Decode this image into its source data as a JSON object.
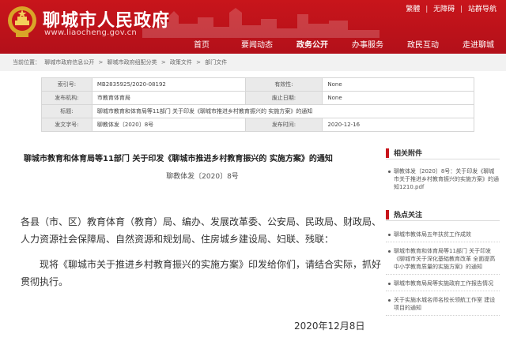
{
  "header": {
    "site_title": "聊城市人民政府",
    "site_url": "www.liaocheng.gov.cn",
    "toplinks": [
      "繁體",
      "无障碍",
      "站群导航"
    ],
    "brand_color": "#c8151b"
  },
  "nav": [
    "首页",
    "要闻动态",
    "政务公开",
    "办事服务",
    "政民互动",
    "走进聊城"
  ],
  "breadcrumb": [
    "当前位置：",
    "聊城市政府信息公开",
    ">",
    "聊城市政府组配分类",
    ">",
    "政策文件",
    ">",
    "部门文件"
  ],
  "info": {
    "index_label": "索引号:",
    "index_value": "MB2835925/2020-08192",
    "validity_label": "有效性:",
    "validity_value": "None",
    "publisher_label": "发布机构:",
    "publisher_value": "市教育体育局",
    "repeal_label": "废止日期:",
    "repeal_value": "None",
    "title_label": "标题:",
    "title_value": "聊城市教育和体育局等11部门  关于印发《聊城市推进乡村教育振兴的  实施方案》的通知",
    "docno_label": "发文字号:",
    "docno_value": "聊教体发〔2020〕8号",
    "date_label": "发布时间:",
    "date_value": "2020-12-16"
  },
  "article": {
    "title": "聊城市教育和体育局等11部门   关于印发《聊城市推进乡村教育振兴的   实施方案》的通知",
    "number": "聊教体发〔2020〕8号",
    "para1": "各县（市、区）教育体育（教育）局、编办、发展改革委、公安局、民政局、财政局、人力资源社会保障局、自然资源和规划局、住房城乡建设局、妇联、残联：",
    "para2": "现将《聊城市关于推进乡村教育振兴的实施方案》印发给你们，请结合实际，抓好贯彻执行。",
    "date": "2020年12月8日"
  },
  "sidebar": {
    "attach_title": "相关附件",
    "attachment": "聊教体发〔2020〕8号：关于印发《聊城市关于推进乡村教育振兴的实施方案》的通知1210.pdf",
    "hot_title": "热点关注",
    "hot_items": [
      "聊城市教体局五年扶贫工作成效",
      "聊城市教育和体育局等11部门 关于印发《聊城市关于深化基础教育改革 全面提高中小学教育质量的实施方案》的通知",
      "聊城市教育局局等实施政府工作报告情况",
      "关于实施水城名师名校长领航工作室 建设项目的通知"
    ]
  }
}
